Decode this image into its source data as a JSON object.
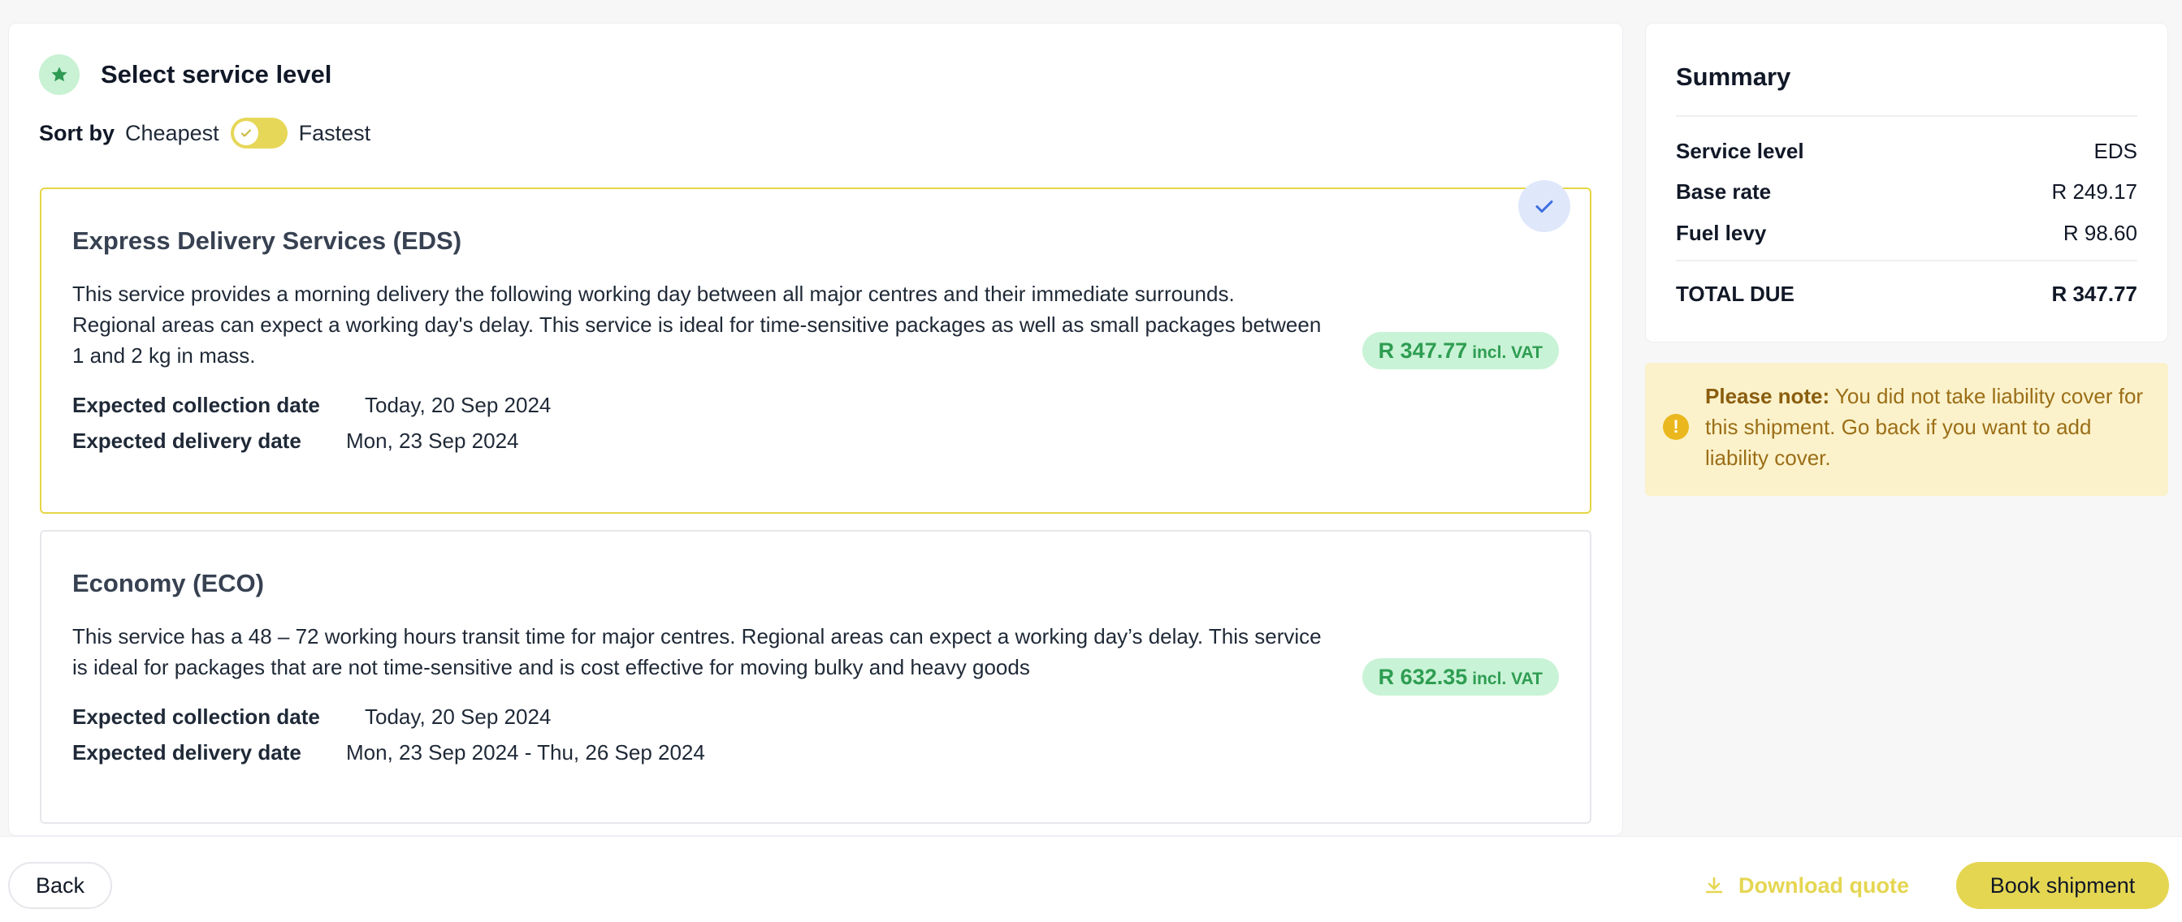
{
  "service_section": {
    "title": "Select service level",
    "sort": {
      "label": "Sort by",
      "left_option": "Cheapest",
      "right_option": "Fastest",
      "selected": "Cheapest"
    }
  },
  "services": [
    {
      "title": "Express Delivery Services (EDS)",
      "description": "This service provides a morning delivery the following working day between all major centres and their immediate surrounds. Regional areas can expect a working day's delay. This service is ideal for time-sensitive packages as well as small packages between 1 and 2 kg in mass.",
      "collection_label": "Expected collection date",
      "collection_value": "Today, 20 Sep 2024",
      "delivery_label": "Expected delivery date",
      "delivery_value": "Mon, 23 Sep 2024",
      "price": "R 347.77",
      "price_suffix": "incl. VAT",
      "selected": true
    },
    {
      "title": "Economy (ECO)",
      "description": "This service has a 48 – 72 working hours transit time for major centres. Regional areas can expect a working day’s delay. This service is ideal for packages that are not time-sensitive and is cost effective for moving bulky and heavy goods",
      "collection_label": "Expected collection date",
      "collection_value": "Today, 20 Sep 2024",
      "delivery_label": "Expected delivery date",
      "delivery_value": "Mon, 23 Sep 2024 - Thu, 26 Sep 2024",
      "price": "R 632.35",
      "price_suffix": "incl. VAT",
      "selected": false
    }
  ],
  "summary": {
    "title": "Summary",
    "rows": [
      {
        "label": "Service level",
        "value": "EDS"
      },
      {
        "label": "Base rate",
        "value": "R 249.17"
      },
      {
        "label": "Fuel levy",
        "value": "R 98.60"
      }
    ],
    "total_label": "TOTAL DUE",
    "total_value": "R 347.77"
  },
  "note": {
    "bold": "Please note:",
    "text": " You did not take liability cover for this shipment. Go back if you want to add liability cover."
  },
  "footer": {
    "back_label": "Back",
    "download_label": "Download quote",
    "book_label": "Book shipment"
  },
  "colors": {
    "accent_yellow": "#e5d652",
    "price_green": "#2e9d52",
    "price_bg": "#c9f3d6",
    "note_bg": "#fbf2cb",
    "check_blue": "#3d6fe0"
  },
  "icons": {
    "section": "star-icon",
    "toggle": "check-icon",
    "selected": "checkmark-icon",
    "note": "exclamation-icon",
    "download": "download-icon"
  }
}
